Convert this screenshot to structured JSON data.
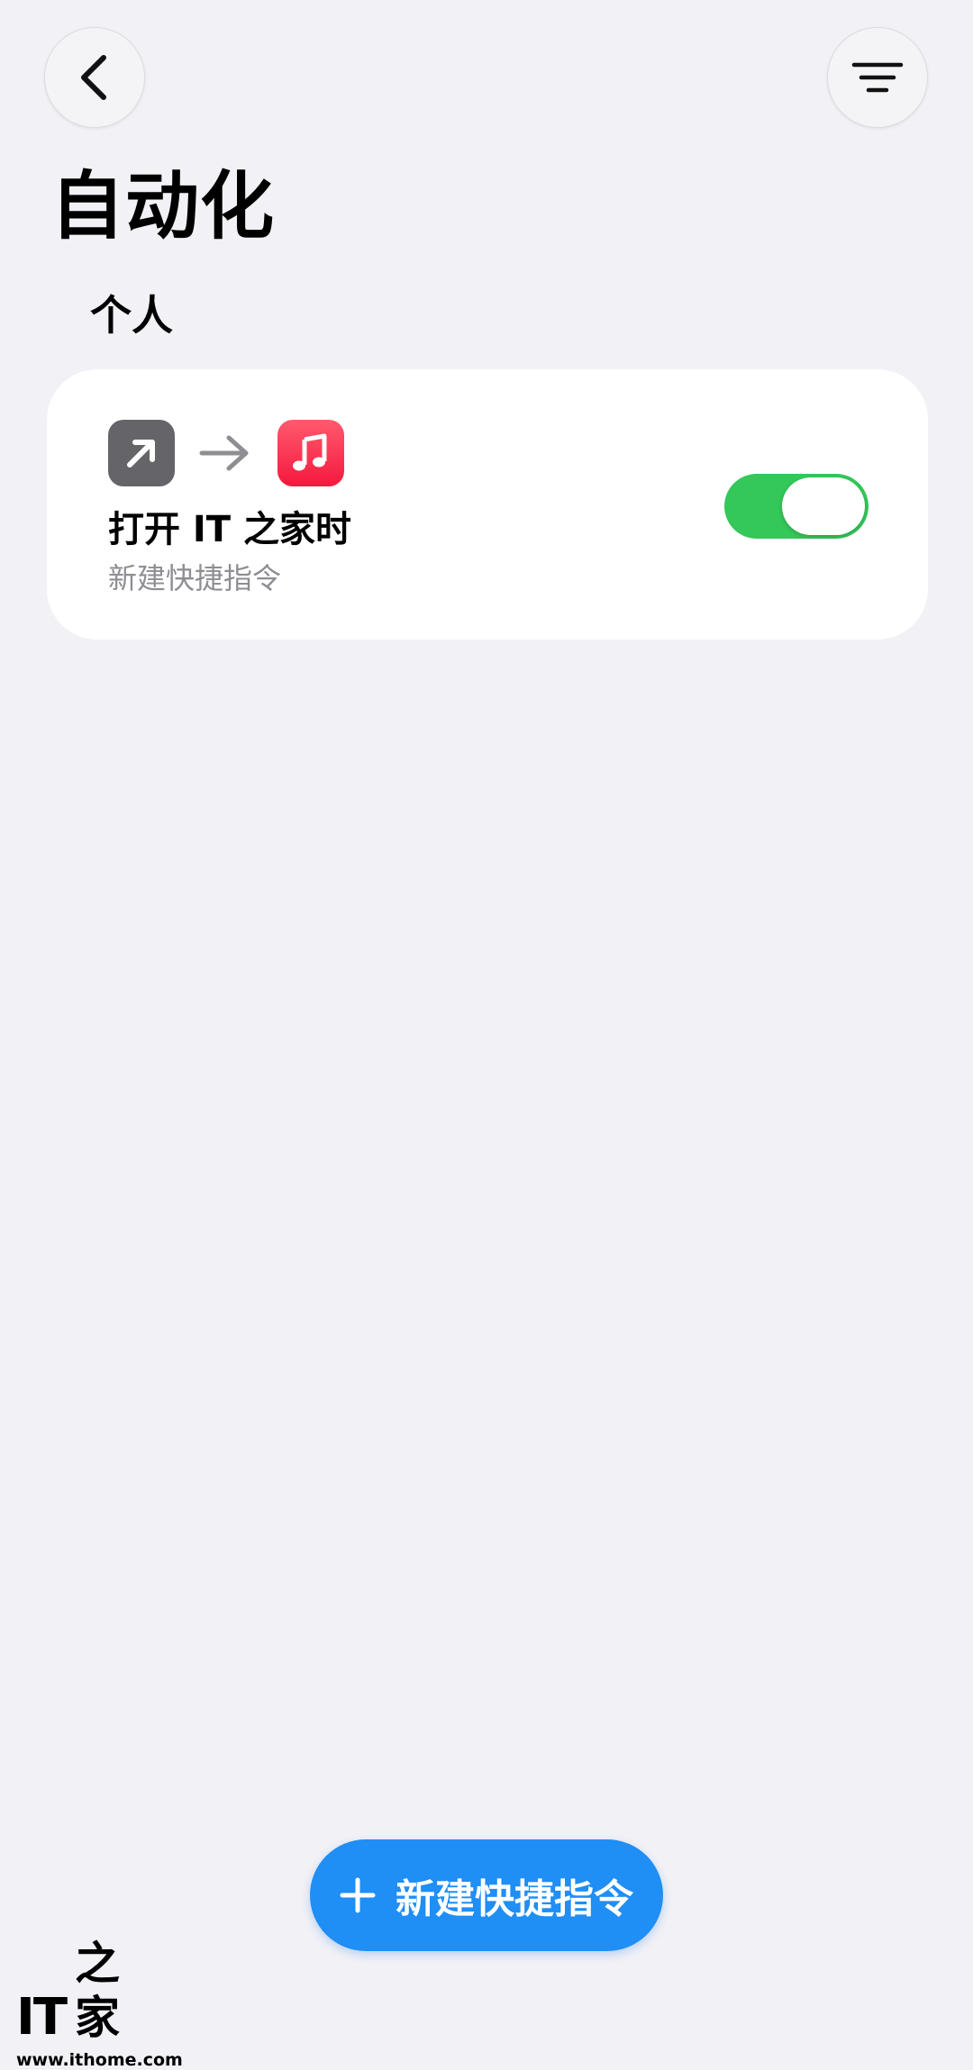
{
  "header": {
    "back_icon": "chevron-left-icon",
    "filter_icon": "filter-lines-icon"
  },
  "page": {
    "title": "自动化",
    "section": "个人"
  },
  "automation": {
    "trigger_icon": "open-app-arrow-icon",
    "action_icon": "music-note-icon",
    "title": "打开 IT 之家时",
    "subtitle": "新建快捷指令",
    "enabled": true,
    "toggle_color": "#34c759"
  },
  "footer": {
    "new_button_label": "新建快捷指令",
    "new_button_color": "#1f8ef5"
  },
  "watermark": {
    "logo_text": "IT",
    "logo_char": "之家",
    "url": "www.ithome.com"
  }
}
